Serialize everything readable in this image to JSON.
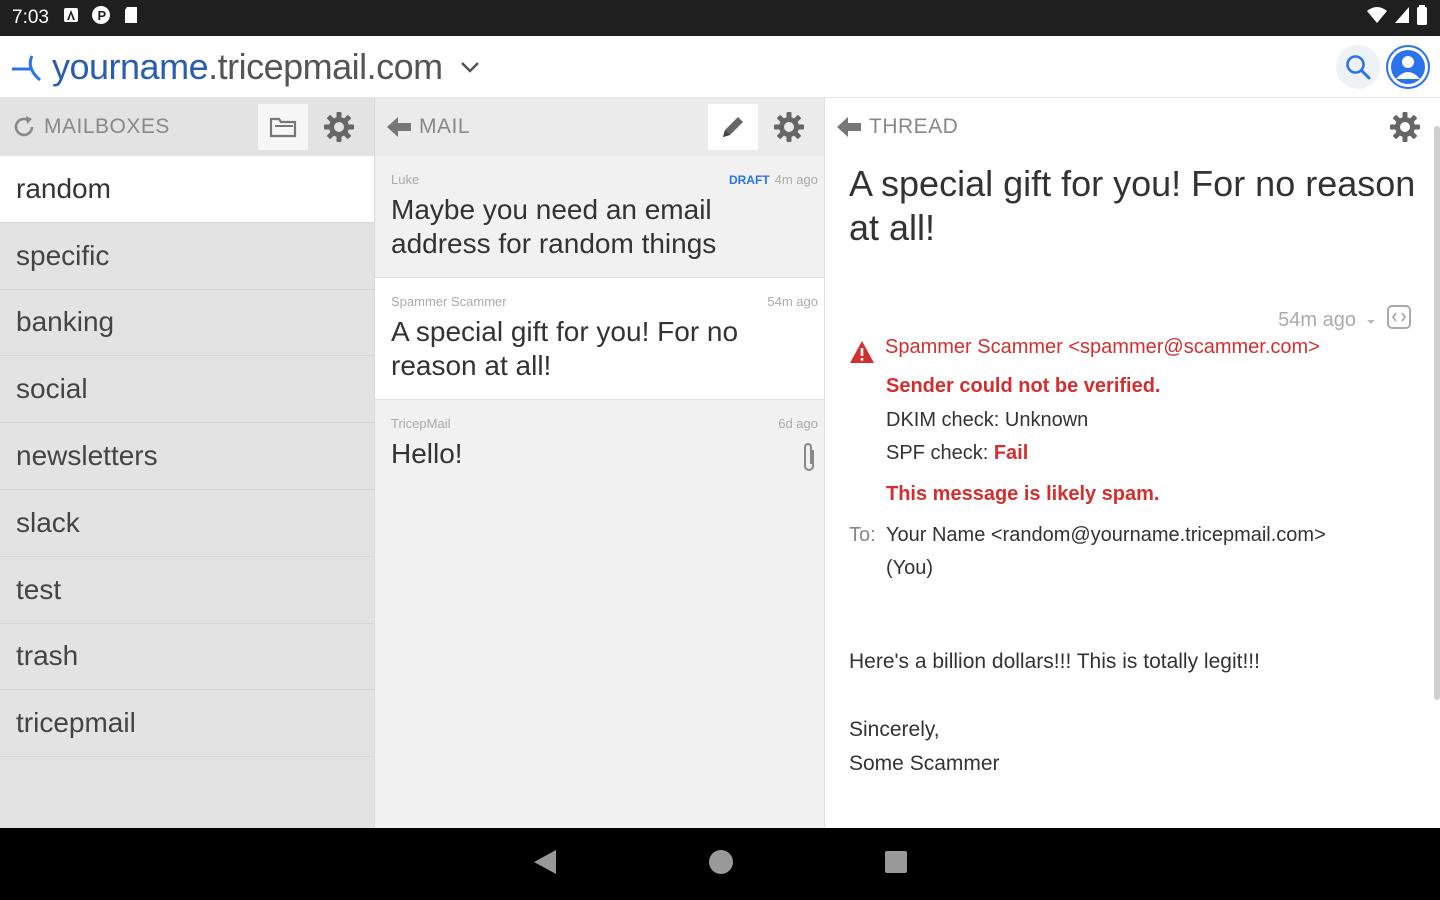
{
  "status": {
    "time": "7:03"
  },
  "appbar": {
    "domain_user": "yourname",
    "domain_rest": ".tricepmail.com"
  },
  "mailboxes": {
    "header": "MAILBOXES",
    "items": [
      "random",
      "specific",
      "banking",
      "social",
      "newsletters",
      "slack",
      "test",
      "trash",
      "tricepmail"
    ],
    "selected": "random"
  },
  "mail": {
    "header": "MAIL",
    "messages": [
      {
        "from": "Luke",
        "draft": "DRAFT",
        "when": "4m ago",
        "subject": "Maybe you need an email address for random things"
      },
      {
        "from": "Spammer Scammer",
        "draft": "",
        "when": "54m ago",
        "subject": "A special gift for you! For no reason at all!"
      },
      {
        "from": "TricepMail",
        "draft": "",
        "when": "6d ago",
        "subject": "Hello!"
      }
    ]
  },
  "thread": {
    "header": "THREAD",
    "title": "A special gift for you! For no reason at all!",
    "when": "54m ago",
    "sender": "Spammer Scammer <spammer@scammer.com>",
    "unverified": "Sender could not be verified.",
    "dkim": "DKIM check: Unknown",
    "spf_label": "SPF check: ",
    "spf_value": "Fail",
    "spam_notice": "This message is likely spam.",
    "to_label": "To:",
    "to_value": "Your Name <random@yourname.tricepmail.com>",
    "to_you": "(You)",
    "body_line1": "Here's a billion dollars!!! This is totally legit!!!",
    "body_line2": "Sincerely,",
    "body_line3": "Some Scammer"
  },
  "colors": {
    "accent": "#2a73e8",
    "warning": "#d32f2f",
    "brand": "#2a5db0"
  }
}
